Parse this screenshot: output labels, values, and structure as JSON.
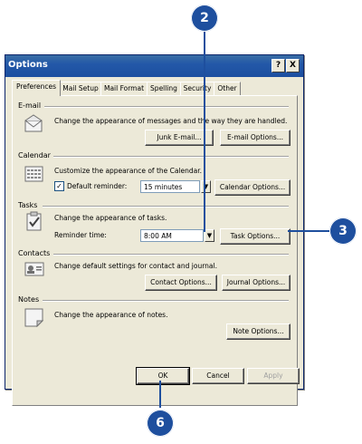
{
  "window": {
    "title": "Options",
    "help_label": "?",
    "close_label": "X"
  },
  "tabs": [
    {
      "label": "Preferences",
      "active": true
    },
    {
      "label": "Mail Setup",
      "active": false
    },
    {
      "label": "Mail Format",
      "active": false
    },
    {
      "label": "Spelling",
      "active": false
    },
    {
      "label": "Security",
      "active": false
    },
    {
      "label": "Other",
      "active": false
    }
  ],
  "email": {
    "section_label": "E-mail",
    "description": "Change the appearance of messages and the way they are handled.",
    "junk_button": "Junk E-mail...",
    "options_button": "E-mail Options..."
  },
  "calendar": {
    "section_label": "Calendar",
    "description": "Customize the appearance of the Calendar.",
    "default_reminder_label": "Default reminder:",
    "default_reminder_checked": true,
    "reminder_value": "15 minutes",
    "options_button": "Calendar Options..."
  },
  "tasks": {
    "section_label": "Tasks",
    "description": "Change the appearance of tasks.",
    "reminder_time_label": "Reminder time:",
    "reminder_time_value": "8:00 AM",
    "options_button": "Task Options..."
  },
  "contacts": {
    "section_label": "Contacts",
    "description": "Change default settings for contact and journal.",
    "contact_options_button": "Contact Options...",
    "journal_options_button": "Journal Options..."
  },
  "notes": {
    "section_label": "Notes",
    "description": "Change the appearance of notes.",
    "options_button": "Note Options..."
  },
  "footer": {
    "ok": "OK",
    "cancel": "Cancel",
    "apply": "Apply"
  },
  "callouts": {
    "c2": "2",
    "c3": "3",
    "c6": "6"
  },
  "colors": {
    "callout": "#1e4f9e",
    "titlebar": "#2358a8",
    "dialog_bg": "#ece9d8"
  }
}
